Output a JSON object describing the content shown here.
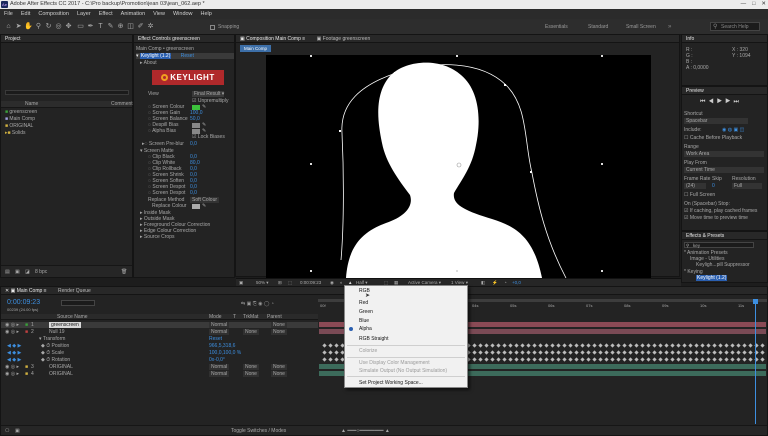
{
  "window": {
    "title": "Adobe After Effects CC 2017 - C:\\Pro backup\\Promotion\\jean 03\\jean_062.aep *",
    "controls": [
      "—",
      "□",
      "✕"
    ]
  },
  "menu": [
    "File",
    "Edit",
    "Composition",
    "Layer",
    "Effect",
    "Animation",
    "View",
    "Window",
    "Help"
  ],
  "toolbar": {
    "snapping": "Snapping",
    "workspaces": [
      "Essentials",
      "Standard",
      "Small Screen"
    ],
    "search_help": "Search Help"
  },
  "project": {
    "tab": "Project",
    "columns": [
      "Name",
      "Comment"
    ],
    "items": [
      "greenscreen",
      "Main Comp",
      "ORIGINAL",
      "Solids"
    ]
  },
  "effect_controls": {
    "tab": "Effect Controls greenscreen",
    "comp_line": "Main Comp • greenscreen",
    "effect_name": "Keylight (1.2)",
    "reset": "Reset",
    "about": "About",
    "logo": "KEYLIGHT",
    "view_label": "View",
    "view_value": "Final Result",
    "unpremultiply": "Unpremultiply",
    "params": [
      {
        "name": "Screen Colour",
        "value": ""
      },
      {
        "name": "Screen Gain",
        "value": "100,0"
      },
      {
        "name": "Screen Balance",
        "value": "50,0"
      },
      {
        "name": "Despill Bias",
        "value": ""
      },
      {
        "name": "Alpha Bias",
        "value": ""
      },
      {
        "name": "Lock Biases",
        "value": ""
      },
      {
        "name": "Screen Pre-blur",
        "value": "0,0"
      },
      {
        "name": "Screen Matte",
        "value": ""
      },
      {
        "name": "Clip Black",
        "value": "0,0"
      },
      {
        "name": "Clip White",
        "value": "80,0"
      },
      {
        "name": "Clip Rollback",
        "value": "0,0"
      },
      {
        "name": "Screen Shrink",
        "value": "0,0"
      },
      {
        "name": "Screen Soften",
        "value": "0,0"
      },
      {
        "name": "Screen Despot",
        "value": "0,0"
      },
      {
        "name": "Screen Despot",
        "value": "0,0"
      },
      {
        "name": "Replace Method",
        "value": "Soft Colour"
      },
      {
        "name": "Replace Colour",
        "value": ""
      },
      {
        "name": "Inside Mask",
        "value": ""
      },
      {
        "name": "Outside Mask",
        "value": ""
      },
      {
        "name": "Foreground Colour Correction",
        "value": ""
      },
      {
        "name": "Edge Colour Correction",
        "value": ""
      },
      {
        "name": "Source Crops",
        "value": ""
      }
    ]
  },
  "composition": {
    "tabs": [
      "Composition Main Comp",
      "Footage greenscreen"
    ],
    "subtab": "Main Comp",
    "bottom": {
      "zoom": "50%",
      "time": "0:00:09:23",
      "resolution": "Half",
      "camera": "Active Camera",
      "views": "1 View",
      "exposure": "+0,0"
    }
  },
  "channel_menu": {
    "items": [
      {
        "label": "RGB",
        "disabled": false,
        "selected": false
      },
      {
        "label": "Red",
        "disabled": false,
        "selected": false
      },
      {
        "label": "Green",
        "disabled": false,
        "selected": false
      },
      {
        "label": "Blue",
        "disabled": false,
        "selected": false
      },
      {
        "label": "Alpha",
        "disabled": false,
        "selected": true
      },
      {
        "label": "RGB Straight",
        "disabled": false,
        "selected": false
      },
      {
        "label": "Colorize",
        "disabled": true,
        "selected": false
      },
      {
        "label": "Use Display Color Management",
        "disabled": true,
        "selected": false
      },
      {
        "label": "Simulate Output (No Output Simulation)",
        "disabled": true,
        "selected": false
      },
      {
        "label": "Set Project Working Space...",
        "disabled": false,
        "selected": false
      }
    ]
  },
  "info": {
    "tab": "Info",
    "r": "R :",
    "g": "G :",
    "b": "B :",
    "a": "A : 0,0000",
    "x": "X : 320",
    "y": "Y : 1094"
  },
  "preview": {
    "tab": "Preview",
    "shortcut_label": "Shortcut",
    "shortcut_value": "Spacebar",
    "include": "Include:",
    "cache": "Cache Before Playback",
    "range_label": "Range",
    "range_value": "Work Area",
    "play_from_label": "Play From",
    "play_from_value": "Current Time",
    "frame_rate_label": "Frame Rate",
    "skip_label": "Skip",
    "resolution_label": "Resolution",
    "frame_rate_value": "(24)",
    "skip_value": "0",
    "resolution_value": "Full",
    "fullscreen": "Full Screen",
    "on_stop": "On (Spacebar) Stop:",
    "if_caching": "If caching, play cached frames",
    "move_time": "Move time to preview time"
  },
  "effects_presets": {
    "tab": "Effects & Presets",
    "search": "key",
    "items": [
      "* Animation Presets",
      "Image - Utilities",
      "Keyligh...pill Suppressor",
      "* Keying",
      "Keylight (1.2)"
    ]
  },
  "timeline": {
    "tabs": [
      "Main Comp",
      "Render Queue"
    ],
    "time": "0:00:09:23",
    "frames": "00239 (24.00 fps)",
    "columns": [
      "Source Name",
      "Mode",
      "T",
      "TrkMat",
      "Parent"
    ],
    "layers": [
      {
        "num": "1",
        "name": "greenscreen",
        "mode": "Normal",
        "trkmat": "",
        "parent": "None"
      },
      {
        "num": "2",
        "name": "Null 19",
        "mode": "Normal",
        "trkmat": "None",
        "parent": "None"
      }
    ],
    "transform": "Transform",
    "reset": "Reset",
    "props": [
      {
        "name": "Position",
        "value": "966,5,318,6"
      },
      {
        "name": "Scale",
        "value": "100,0,100,0 %"
      },
      {
        "name": "Rotation",
        "value": "0x-0,0°"
      }
    ],
    "layers_bottom": [
      {
        "num": "3",
        "name": "ORIGINAL",
        "mode": "Normal",
        "trkmat": "None",
        "parent": "None"
      },
      {
        "num": "4",
        "name": "ORIGINAL",
        "mode": "Normal",
        "trkmat": "None",
        "parent": "None"
      }
    ],
    "ruler": [
      "00f",
      "01s",
      "02s",
      "03s",
      "04s",
      "05s",
      "06s",
      "07s",
      "08s",
      "09s",
      "10s",
      "11s"
    ],
    "toggle": "Toggle Switches / Modes"
  }
}
